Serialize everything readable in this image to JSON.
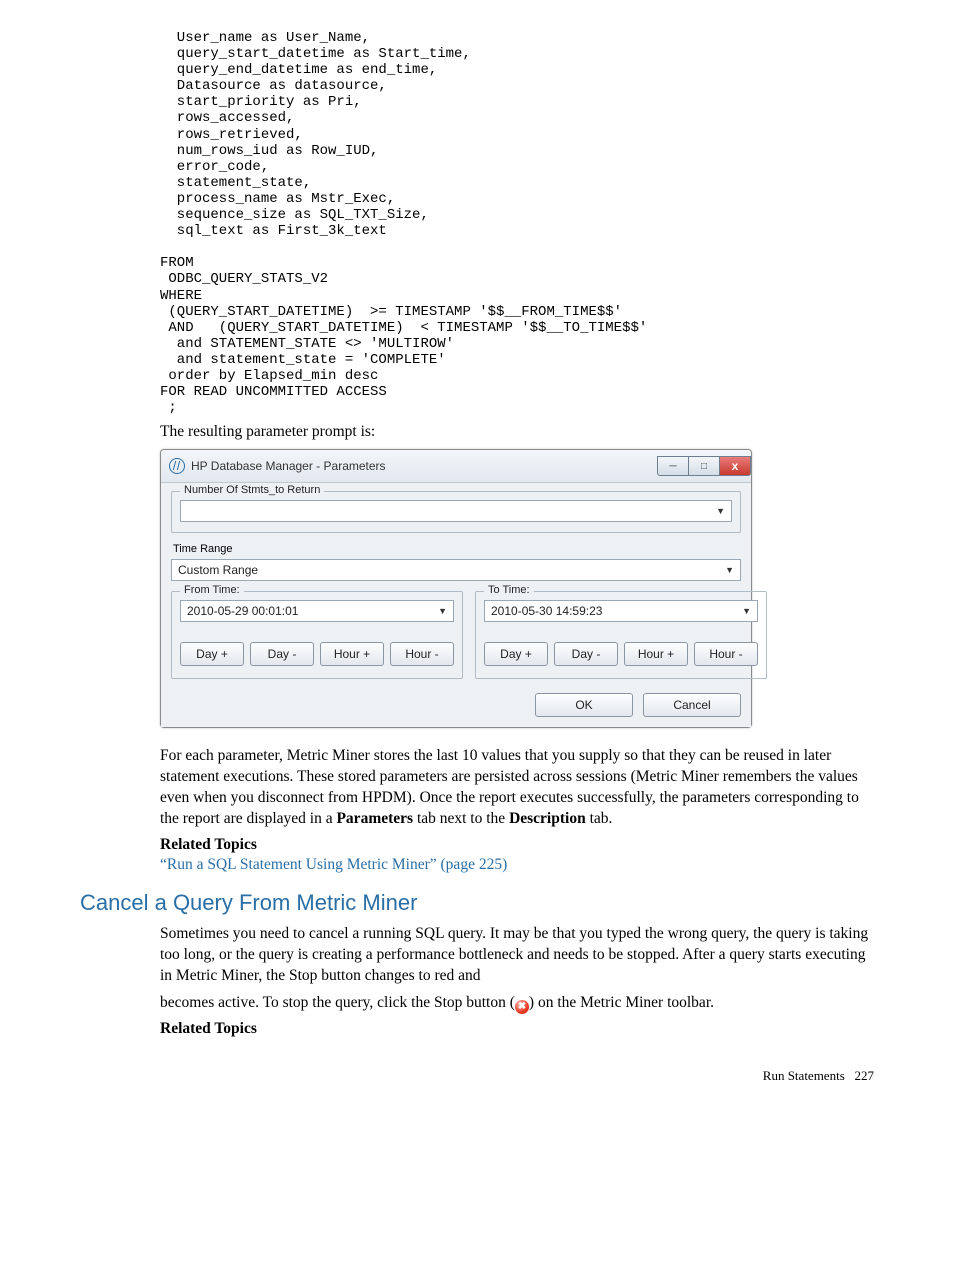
{
  "code": "  User_name as User_Name,\n  query_start_datetime as Start_time,\n  query_end_datetime as end_time,\n  Datasource as datasource,\n  start_priority as Pri,\n  rows_accessed,\n  rows_retrieved,\n  num_rows_iud as Row_IUD,\n  error_code,\n  statement_state,\n  process_name as Mstr_Exec,\n  sequence_size as SQL_TXT_Size,\n  sql_text as First_3k_text\n\nFROM\n ODBC_QUERY_STATS_V2\nWHERE\n (QUERY_START_DATETIME)  >= TIMESTAMP '$$__FROM_TIME$$'\n AND   (QUERY_START_DATETIME)  < TIMESTAMP '$$__TO_TIME$$'\n  and STATEMENT_STATE <> 'MULTIROW'\n  and statement_state = 'COMPLETE'\n order by Elapsed_min desc\nFOR READ UNCOMMITTED ACCESS\n ;",
  "intro_text": "The resulting parameter prompt is:",
  "dialog": {
    "title": "HP Database Manager - Parameters",
    "min_label": "—",
    "max_label": "❐",
    "close_label": "x",
    "num_stmts_legend": "Number Of Stmts_to Return",
    "num_stmts_value": "",
    "time_range_label": "Time Range",
    "time_range_value": "Custom Range",
    "from_legend": "From Time:",
    "from_value": "2010-05-29 00:01:01",
    "to_legend": "To Time:",
    "to_value": "2010-05-30 14:59:23",
    "btn_day_plus": "Day +",
    "btn_day_minus": "Day -",
    "btn_hour_plus": "Hour +",
    "btn_hour_minus": "Hour -",
    "ok": "OK",
    "cancel": "Cancel"
  },
  "para1_a": "For each parameter, Metric Miner stores the last 10 values that you supply so that they can be reused in later statement executions. These stored parameters are persisted across sessions (Metric Miner remembers the values even when you disconnect from HPDM). Once the report executes successfully, the parameters corresponding to the report are displayed in a ",
  "para1_b": "Parameters",
  "para1_c": " tab next to the ",
  "para1_d": "Description",
  "para1_e": " tab.",
  "related_topics": "Related Topics",
  "link1": "“Run a SQL Statement Using Metric Miner” (page 225)",
  "heading2": "Cancel a Query From Metric Miner",
  "para2": "Sometimes you need to cancel a running SQL query. It may be that you typed the wrong query, the query is taking too long, or the query is creating a performance bottleneck and needs to be stopped. After a query starts executing in Metric Miner, the Stop button changes to red and",
  "para3_a": "becomes active. To stop the query, click the Stop button (",
  "para3_b": ") on the Metric Miner toolbar.",
  "stop_glyph": "✖",
  "footer_section": "Run Statements",
  "footer_page": "227"
}
